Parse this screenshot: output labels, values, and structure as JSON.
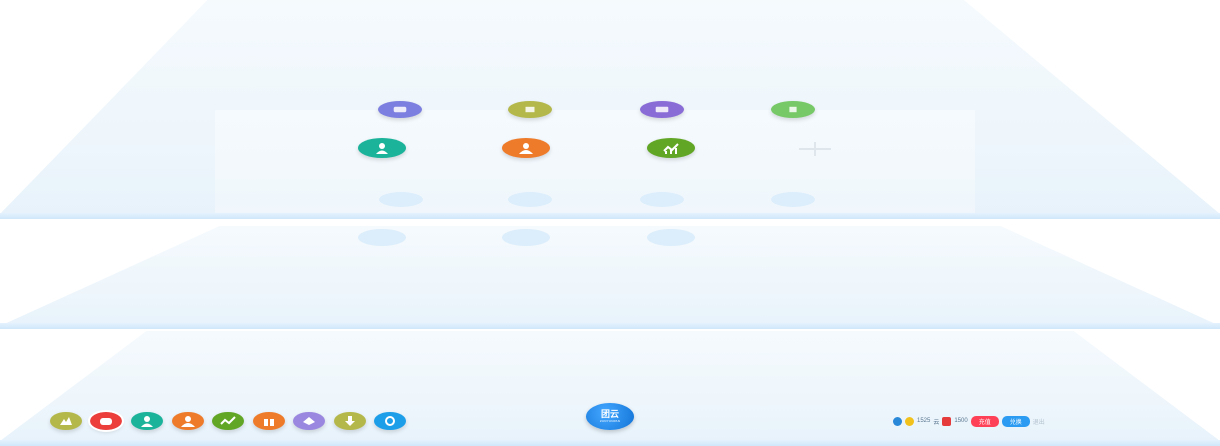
{
  "colors": {
    "purple": "#7d7fe0",
    "olive": "#b4b84a",
    "violet": "#8a6cd7",
    "green": "#77c968",
    "teal": "#1bb39a",
    "orange": "#ee7b2a",
    "leaf": "#62a626",
    "red": "#ec3e3b",
    "yellow": "#e3a514",
    "lavender": "#9a87e0",
    "blue": "#1d9ee8"
  },
  "top_row": [
    {
      "name": "purple-pill",
      "color": "#7d7fe0",
      "icon": "chat-icon"
    },
    {
      "name": "olive-pill",
      "color": "#b4b84a",
      "icon": "book-icon"
    },
    {
      "name": "violet-pill",
      "color": "#8a6cd7",
      "icon": "mail-icon"
    },
    {
      "name": "green-pill",
      "color": "#77c968",
      "icon": "shop-icon"
    }
  ],
  "main_row": [
    {
      "name": "user-app",
      "color": "#1bb39a",
      "icon": "user-icon"
    },
    {
      "name": "contacts-app",
      "color": "#ee7b2a",
      "icon": "group-icon"
    },
    {
      "name": "stats-app",
      "color": "#62a626",
      "icon": "chart-icon"
    }
  ],
  "add_app_icon": "plus-icon",
  "dock": [
    {
      "name": "dock-apps",
      "color": "#b4b84a",
      "icon": "apps-icon"
    },
    {
      "name": "dock-games",
      "color": "#ec3e3b",
      "icon": "gamepad-icon"
    },
    {
      "name": "dock-user",
      "color": "#1bb39a",
      "icon": "user-icon"
    },
    {
      "name": "dock-group",
      "color": "#ee7b2a",
      "icon": "group-icon"
    },
    {
      "name": "dock-stats",
      "color": "#62a626",
      "icon": "chart-icon"
    },
    {
      "name": "dock-gift",
      "color": "#ee7b2a",
      "icon": "gift-icon"
    },
    {
      "name": "dock-cloud",
      "color": "#9a87e0",
      "icon": "cloud-icon"
    },
    {
      "name": "dock-download",
      "color": "#b4b84a",
      "icon": "download-icon"
    },
    {
      "name": "dock-search",
      "color": "#1d9ee8",
      "icon": "search-icon"
    }
  ],
  "logo": {
    "mark": "团云",
    "sub": "ZUNYUNPAN"
  },
  "status": {
    "user_icon": "user-icon",
    "coin_icon": "coin-icon",
    "coins": "1525",
    "coins_unit": "云",
    "gift_icon": "gift-icon",
    "points": "1500",
    "btn_charge": "充值",
    "btn_exchange": "兑换",
    "exit": "退出"
  }
}
